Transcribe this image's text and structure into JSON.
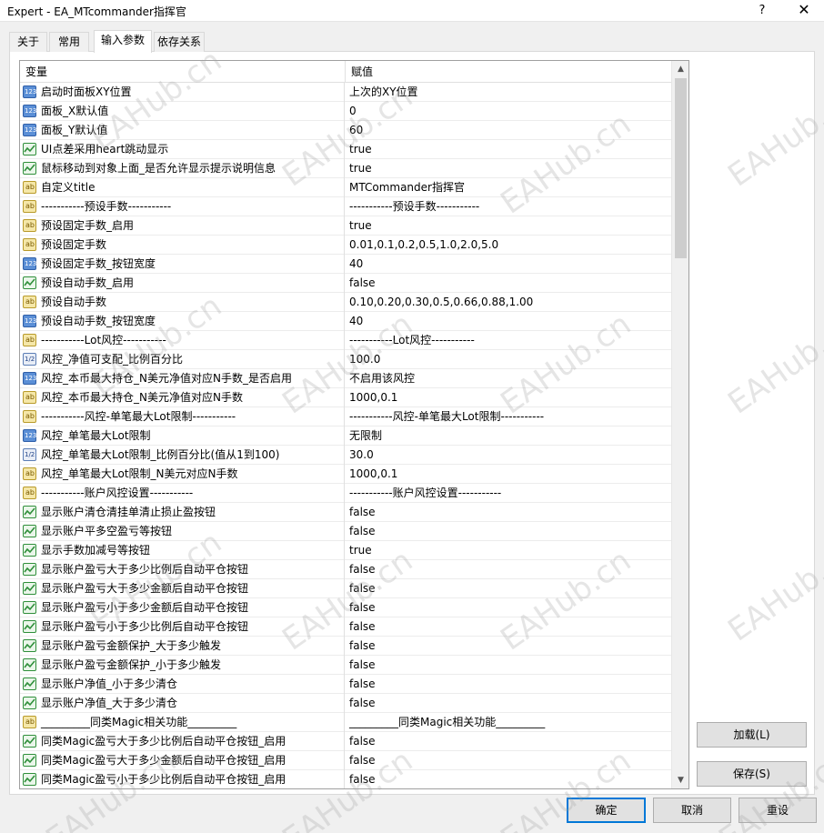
{
  "window": {
    "title": "Expert - EA_MTcommander指挥官",
    "help_label": "?",
    "close_label": "✕"
  },
  "tabs": [
    {
      "label": "关于",
      "active": false
    },
    {
      "label": "常用",
      "active": false
    },
    {
      "label": "输入参数",
      "active": true
    },
    {
      "label": "依存关系",
      "active": false
    }
  ],
  "table": {
    "col_variable": "变量",
    "col_value": "赋值",
    "rows": [
      {
        "type": "num",
        "name": "启动时面板XY位置",
        "value": "上次的XY位置"
      },
      {
        "type": "num",
        "name": "面板_X默认值",
        "value": "0"
      },
      {
        "type": "num",
        "name": "面板_Y默认值",
        "value": "60"
      },
      {
        "type": "bool",
        "name": "UI点差采用heart跳动显示",
        "value": "true"
      },
      {
        "type": "bool",
        "name": "鼠标移动到对象上面_是否允许显示提示说明信息",
        "value": "true"
      },
      {
        "type": "str",
        "name": "自定义title",
        "value": "MTCommander指挥官"
      },
      {
        "type": "str",
        "name": "-----------预设手数-----------",
        "value": "-----------预设手数-----------"
      },
      {
        "type": "str",
        "name": "预设固定手数_启用",
        "value": "true"
      },
      {
        "type": "str",
        "name": "预设固定手数",
        "value": "0.01,0.1,0.2,0.5,1.0,2.0,5.0"
      },
      {
        "type": "num",
        "name": "预设固定手数_按钮宽度",
        "value": "40"
      },
      {
        "type": "bool",
        "name": "预设自动手数_启用",
        "value": "false"
      },
      {
        "type": "str",
        "name": "预设自动手数",
        "value": "0.10,0.20,0.30,0.5,0.66,0.88,1.00"
      },
      {
        "type": "num",
        "name": "预设自动手数_按钮宽度",
        "value": "40"
      },
      {
        "type": "str",
        "name": "-----------Lot风控-----------",
        "value": "-----------Lot风控-----------"
      },
      {
        "type": "dbl",
        "name": "风控_净值可支配_比例百分比",
        "value": "100.0"
      },
      {
        "type": "num",
        "name": "风控_本币最大持仓_N美元净值对应N手数_是否启用",
        "value": "不启用该风控"
      },
      {
        "type": "str",
        "name": "风控_本币最大持仓_N美元净值对应N手数",
        "value": "1000,0.1"
      },
      {
        "type": "str",
        "name": "-----------风控-单笔最大Lot限制-----------",
        "value": "-----------风控-单笔最大Lot限制-----------"
      },
      {
        "type": "num",
        "name": "风控_单笔最大Lot限制",
        "value": "无限制"
      },
      {
        "type": "dbl",
        "name": "风控_单笔最大Lot限制_比例百分比(值从1到100)",
        "value": "30.0"
      },
      {
        "type": "str",
        "name": "风控_单笔最大Lot限制_N美元对应N手数",
        "value": "1000,0.1"
      },
      {
        "type": "str",
        "name": "-----------账户风控设置-----------",
        "value": "-----------账户风控设置-----------"
      },
      {
        "type": "bool",
        "name": "显示账户清仓清挂单清止损止盈按钮",
        "value": "false"
      },
      {
        "type": "bool",
        "name": "显示账户平多空盈亏等按钮",
        "value": "false"
      },
      {
        "type": "bool",
        "name": "显示手数加减号等按钮",
        "value": "true"
      },
      {
        "type": "bool",
        "name": "显示账户盈亏大于多少比例后自动平仓按钮",
        "value": "false"
      },
      {
        "type": "bool",
        "name": "显示账户盈亏大于多少金额后自动平仓按钮",
        "value": "false"
      },
      {
        "type": "bool",
        "name": "显示账户盈亏小于多少金额后自动平仓按钮",
        "value": "false"
      },
      {
        "type": "bool",
        "name": "显示账户盈亏小于多少比例后自动平仓按钮",
        "value": "false"
      },
      {
        "type": "bool",
        "name": "显示账户盈亏金额保护_大于多少触发",
        "value": "false"
      },
      {
        "type": "bool",
        "name": "显示账户盈亏金额保护_小于多少触发",
        "value": "false"
      },
      {
        "type": "bool",
        "name": "显示账户净值_小于多少清仓",
        "value": "false"
      },
      {
        "type": "bool",
        "name": "显示账户净值_大于多少清仓",
        "value": "false"
      },
      {
        "type": "str",
        "name": "_________同类Magic相关功能_________",
        "value": "_________同类Magic相关功能_________"
      },
      {
        "type": "bool",
        "name": "同类Magic盈亏大于多少比例后自动平仓按钮_启用",
        "value": "false"
      },
      {
        "type": "bool",
        "name": "同类Magic盈亏大于多少金额后自动平仓按钮_启用",
        "value": "false"
      },
      {
        "type": "bool",
        "name": "同类Magic盈亏小于多少比例后自动平仓按钮_启用",
        "value": "false"
      }
    ]
  },
  "icons": {
    "num": "integer-type-icon",
    "dbl": "double-type-icon",
    "bool": "boolean-type-icon",
    "str": "string-type-icon",
    "num_text": "123",
    "dbl_text": "1/2",
    "str_text": "ab"
  },
  "buttons": {
    "load": "加载(L)",
    "save": "保存(S)",
    "ok": "确定",
    "cancel": "取消",
    "reset": "重设"
  },
  "watermark": "EAHub.cn",
  "colors": {
    "accent": "#0078d7",
    "bool_icon": "#2f8f3a",
    "num_icon": "#5b8fd6",
    "str_icon": "#f5e7a8"
  }
}
